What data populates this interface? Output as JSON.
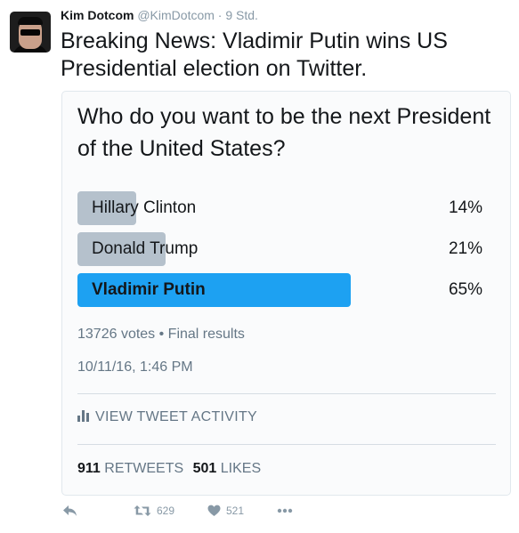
{
  "author": {
    "name": "Kim Dotcom",
    "handle": "@KimDotcom",
    "separator": "·",
    "time": "9 Std."
  },
  "tweet": {
    "text": "Breaking News: Vladimir Putin wins US Presidential election on Twitter."
  },
  "poll": {
    "question": "Who do you want to be the next President of the United States?",
    "options": [
      {
        "label": "Hillary Clinton",
        "percent_text": "14%",
        "percent": 14,
        "winner": false
      },
      {
        "label": "Donald Trump",
        "percent_text": "21%",
        "percent": 21,
        "winner": false
      },
      {
        "label": "Vladimir Putin",
        "percent_text": "65%",
        "percent": 65,
        "winner": true
      }
    ],
    "votes_summary": "13726 votes • Final results",
    "timestamp": "10/11/16, 1:46 PM"
  },
  "activity": {
    "label": "VIEW TWEET ACTIVITY"
  },
  "stats": {
    "retweets_count": "911",
    "retweets_label": "RETWEETS",
    "likes_count": "501",
    "likes_label": "LIKES"
  },
  "actions": {
    "retweet_count": "629",
    "like_count": "521"
  },
  "colors": {
    "winner_bar": "#1da1f2",
    "loser_bar": "#b5c1cc",
    "text": "#14171a",
    "muted": "#657786"
  }
}
